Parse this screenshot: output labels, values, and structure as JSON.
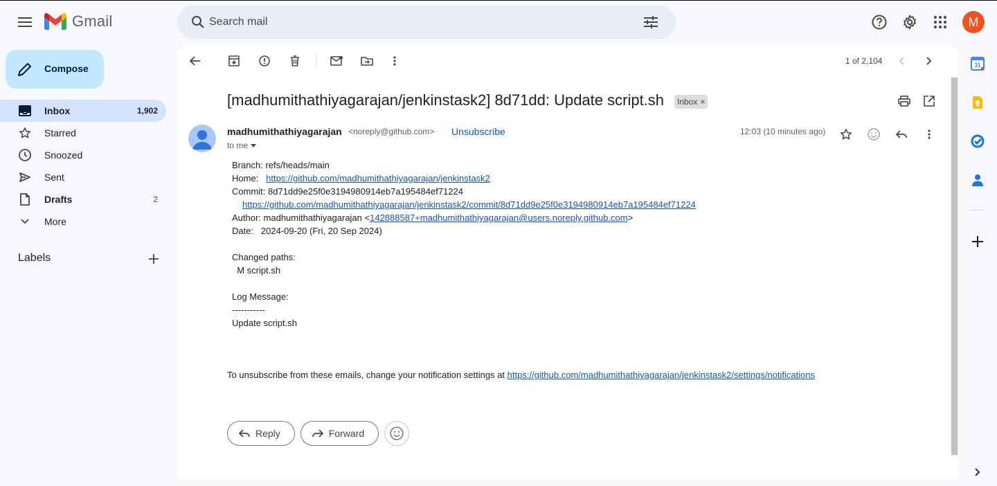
{
  "app": {
    "name": "Gmail"
  },
  "search": {
    "placeholder": "Search mail"
  },
  "account": {
    "initial": "M",
    "color": "#f4511e"
  },
  "compose": {
    "label": "Compose"
  },
  "nav": [
    {
      "label": "Inbox",
      "count": "1,902",
      "icon": "inbox-icon"
    },
    {
      "label": "Starred",
      "count": "",
      "icon": "star-icon"
    },
    {
      "label": "Snoozed",
      "count": "",
      "icon": "clock-icon"
    },
    {
      "label": "Sent",
      "count": "",
      "icon": "send-icon"
    },
    {
      "label": "Drafts",
      "count": "2",
      "icon": "draft-icon"
    },
    {
      "label": "More",
      "count": "",
      "icon": "chevron-down-icon"
    }
  ],
  "labels": {
    "title": "Labels"
  },
  "pager": {
    "text": "1 of 2,104"
  },
  "message": {
    "subject": "[madhumithathiyagarajan/jenkinstask2] 8d71dd: Update script.sh",
    "label_chip": "Inbox",
    "sender_name": "madhumithathiyagarajan",
    "sender_email": "<noreply@github.com>",
    "unsubscribe": "Unsubscribe",
    "to": "to me",
    "time": "12:03 (10 minutes ago)",
    "body": {
      "branch": "Branch: refs/heads/main",
      "home_label": "Home:   ",
      "home_link": "https://github.com/madhumithathiyagarajan/jenkinstask2",
      "commit": "Commit: 8d71dd9e25f0e3194980914eb7a195484ef71224",
      "commit_link": "https://github.com/madhumithathiyagarajan/jenkinstask2/commit/8d71dd9e25f0e3194980914eb7a195484ef71224",
      "author_prefix": "Author: madhumithathiyagarajan <",
      "author_link": "142888587+madhumithathiyagarajan@users.noreply.github.com",
      "author_suffix": ">",
      "date": "Date:   2024-09-20 (Fri, 20 Sep 2024)",
      "changed_paths": "Changed paths:",
      "changed_file": "  M script.sh",
      "log_message": "Log Message:",
      "log_sep": "-----------",
      "log_text": "Update script.sh"
    },
    "footer_text": "To unsubscribe from these emails, change your notification settings at ",
    "footer_link": "https://github.com/madhumithathiyagarajan/jenkinstask2/settings/notifications"
  },
  "actions": {
    "reply": "Reply",
    "forward": "Forward"
  }
}
